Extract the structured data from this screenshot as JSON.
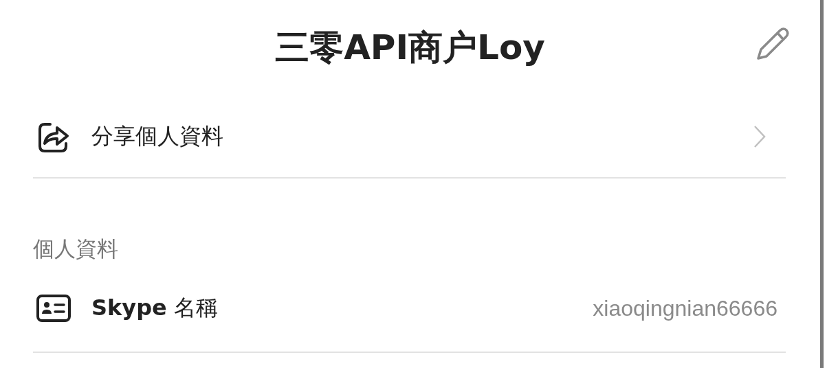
{
  "header": {
    "title": "三零API商户Loy"
  },
  "share_row": {
    "label": "分享個人資料"
  },
  "section": {
    "title": "個人資料"
  },
  "fields": [
    {
      "label": "**Skype** 名稱",
      "value": "xiaoqingnian66666"
    }
  ]
}
